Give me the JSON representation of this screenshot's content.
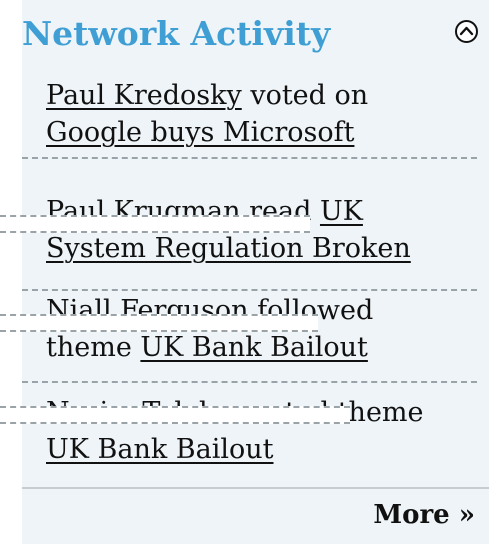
{
  "header": {
    "title": "Network Activity",
    "collapse_icon": "chevron-up-icon"
  },
  "activity": [
    {
      "actor": "Paul Kredosky",
      "action": "voted on",
      "target": "Google buys Microsoft"
    },
    {
      "actor": "Paul Krugman",
      "action": "read",
      "target_part1": "UK",
      "target_part2": "System Regulation Broken"
    },
    {
      "actor": "Niall Ferguson",
      "action": "followed",
      "prefix": "theme",
      "target": "UK Bank Bailout"
    },
    {
      "actor": "Nasim Taleb",
      "action": "created theme",
      "target": "UK Bank Bailout"
    }
  ],
  "footer": {
    "more_label": "More »"
  },
  "colors": {
    "title": "#3f9fd4",
    "panel_bg": "#eef4f7",
    "separator": "#9aa3a8"
  }
}
